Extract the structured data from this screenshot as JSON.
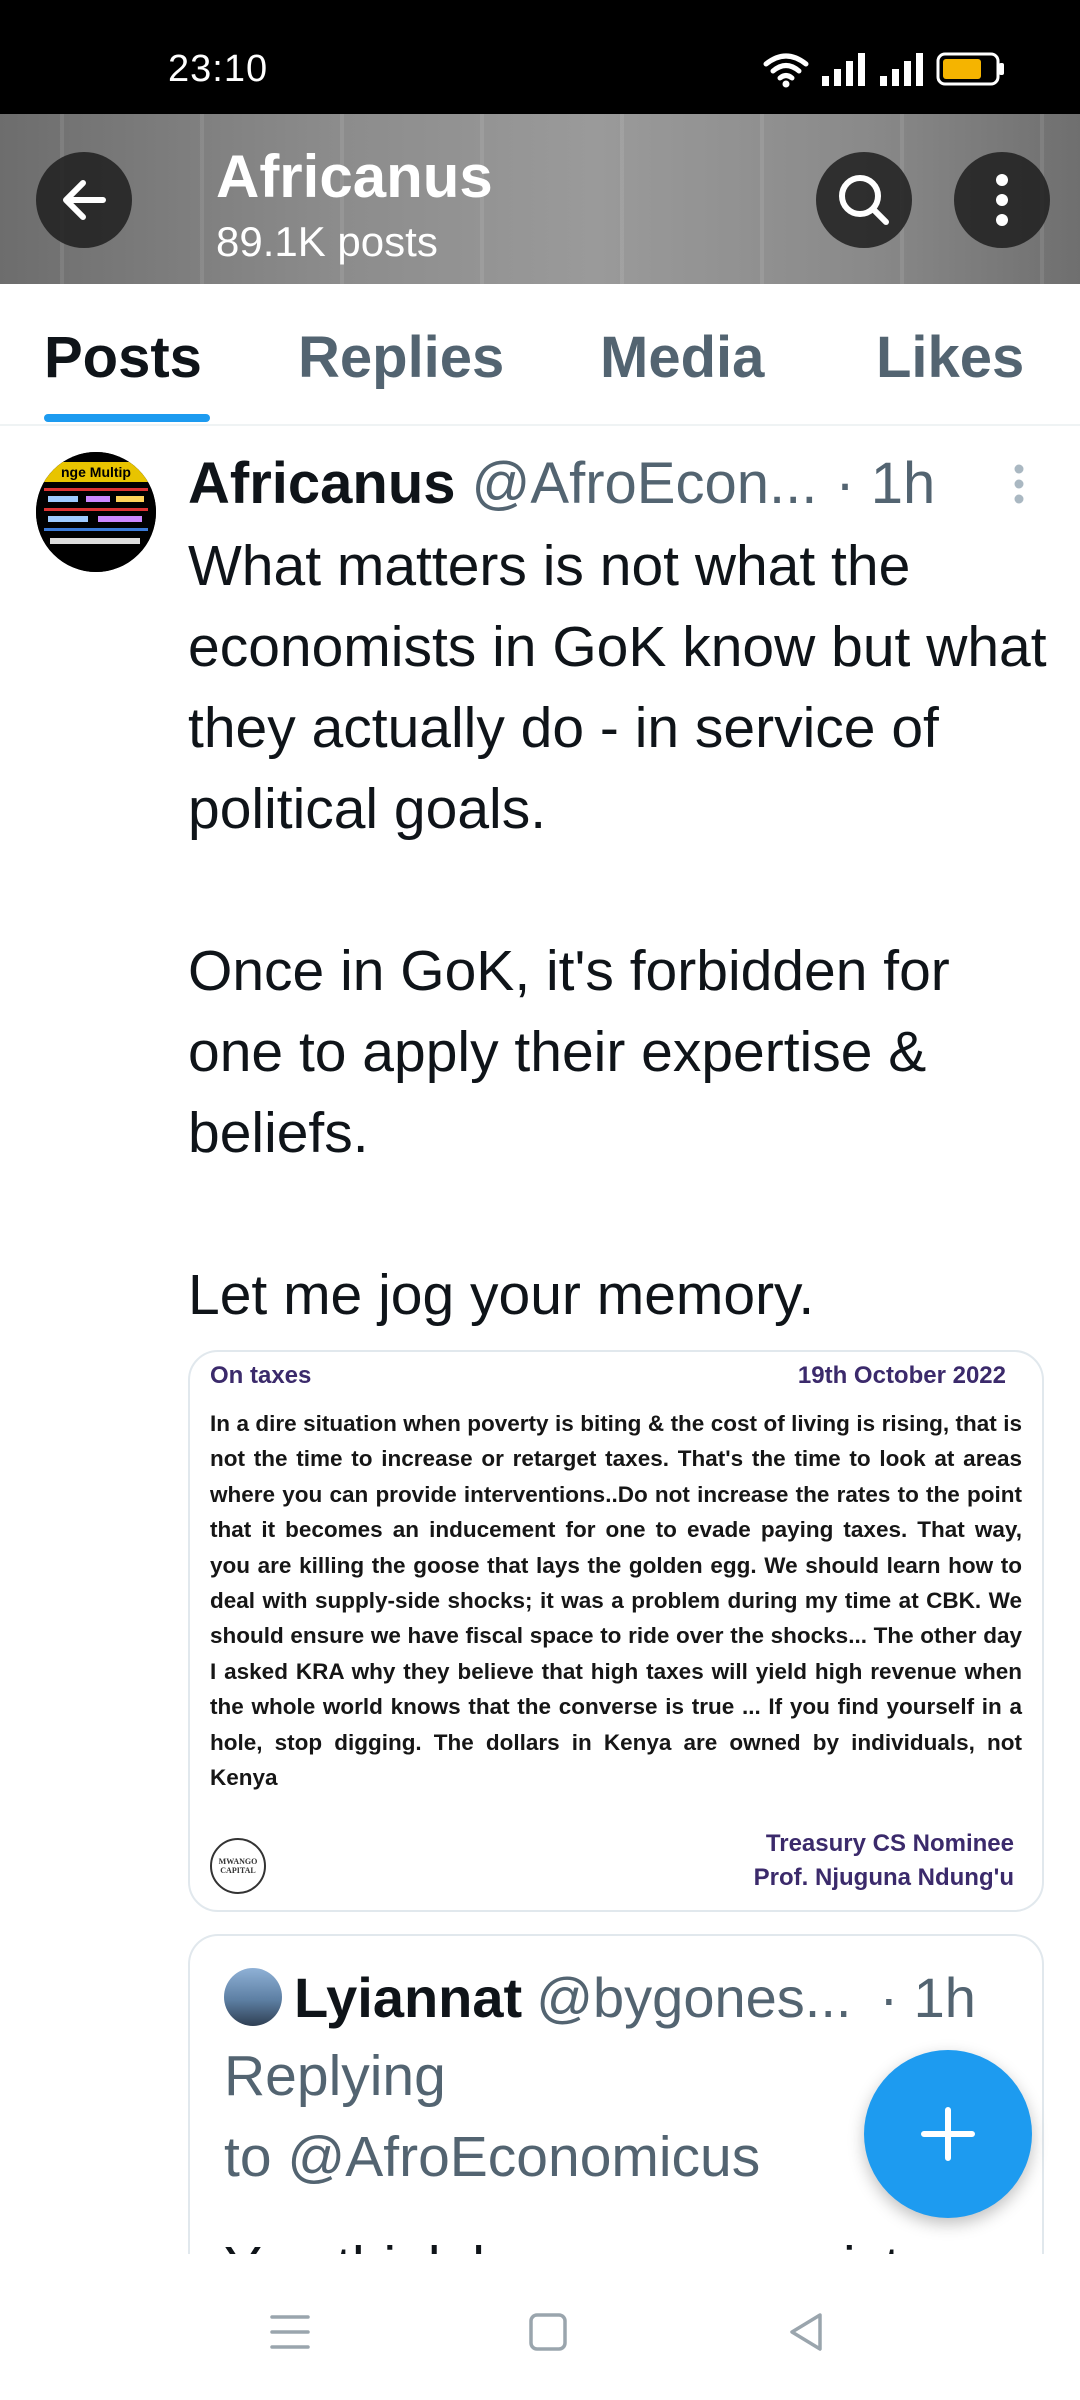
{
  "status_bar": {
    "time": "23:10",
    "icons": [
      "wifi-icon",
      "signal-icon",
      "signal-icon",
      "battery-icon"
    ],
    "battery_color": "#f5b400"
  },
  "header": {
    "name": "Africanus",
    "post_count": "89.1K posts"
  },
  "tabs": [
    {
      "label": "Posts",
      "active": true
    },
    {
      "label": "Replies",
      "active": false
    },
    {
      "label": "Media",
      "active": false
    },
    {
      "label": "Likes",
      "active": false
    }
  ],
  "post": {
    "author_name": "Africanus",
    "handle": "@AfroEcon...",
    "time": "· 1h",
    "avatar_text": "nge Multip",
    "paragraphs": [
      "What matters is not what the economists in GoK know but what they actually do - in service of political goals.",
      "Once in GoK, it's forbidden for one to apply their expertise & beliefs.",
      "Let me jog your memory."
    ],
    "image_card": {
      "topic": "On taxes",
      "date": "19th October 2022",
      "body": "In a dire situation when poverty is biting & the cost of living is rising, that is not the time to increase or retarget taxes. That's the time to look at areas where you can provide interventions..Do not increase the rates to the point that it becomes an inducement for one to evade paying taxes. That way, you are killing the goose that lays the golden egg. We should learn how to deal with supply-side shocks; it was a problem during my time at CBK. We should ensure we have fiscal space to ride over the shocks... The other day I asked KRA why they believe that high taxes will yield high revenue when the whole world knows that the converse is true ... If you find yourself in a hole, stop digging. The dollars in Kenya are owned by individuals, not Kenya",
      "logo_text": "MWANGO CAPITAL",
      "role": "Treasury CS Nominee",
      "person": "Prof. Njuguna Ndung'u"
    }
  },
  "quoted_post": {
    "name": "Lyiannat",
    "handle": "@bygones...",
    "time": "· 1h",
    "reply_prefix": "Replying",
    "reply_to": "to @AfroEconomicus",
    "text_partial": "You think kenya economist"
  },
  "colors": {
    "accent": "#1d9bf0",
    "text_primary": "#0f1419",
    "text_secondary": "#536471",
    "card_purple": "#3b2a6b"
  }
}
